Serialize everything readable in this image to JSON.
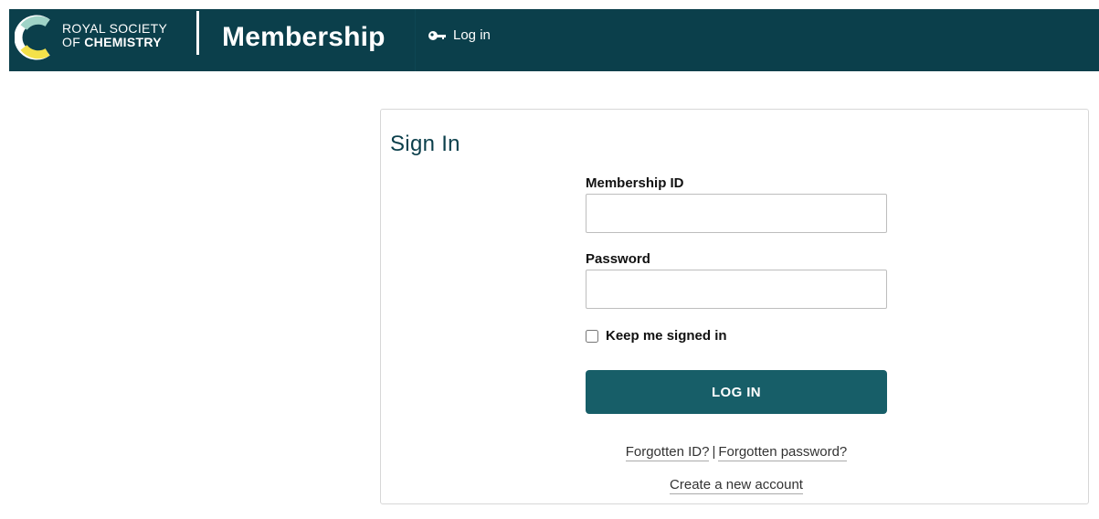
{
  "header": {
    "logo_line1": "ROYAL SOCIETY",
    "logo_line2_prefix": "OF",
    "logo_line2_bold": "CHEMISTRY",
    "title": "Membership",
    "login_link": "Log in",
    "login_icon": "key-icon",
    "logo_icon": "rsc-logo-icon",
    "bg_color": "#0b3f4b"
  },
  "signin": {
    "title": "Sign In",
    "membership_id_label": "Membership ID",
    "membership_id_value": "",
    "password_label": "Password",
    "password_value": "",
    "keep_signed_in_label": "Keep me signed in",
    "keep_signed_in_checked": false,
    "login_button": "LOG IN",
    "button_color": "#175e68",
    "forgotten_id_link": "Forgotten ID?",
    "separator": "|",
    "forgotten_password_link": "Forgotten password?",
    "create_account_link": "Create a new account"
  }
}
